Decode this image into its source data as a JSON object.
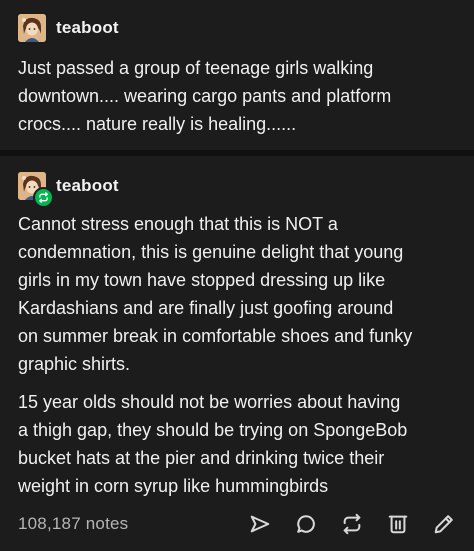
{
  "post": {
    "blocks": [
      {
        "username": "teaboot",
        "text": "Just passed a group of teenage girls walking\ndowntown.... wearing cargo pants and platform\ncrocs.... nature really is healing......"
      },
      {
        "username": "teaboot",
        "paragraphs": [
          "Cannot stress enough that this is NOT a\ncondemnation, this is genuine delight that young\ngirls in my town have stopped dressing up like\nKardashians and are finally just goofing around\non summer break in comfortable shoes and funky\ngraphic shirts.",
          "15 year olds should not be worries about having\na thigh gap, they should be trying on SpongeBob\nbucket hats at the pier and drinking twice their\nweight in corn syrup like hummingbirds"
        ]
      }
    ],
    "footer": {
      "notes": "108,187 notes",
      "actions": [
        "share-icon",
        "reply-icon",
        "reblog-icon",
        "delete-icon",
        "edit-icon"
      ]
    }
  },
  "colors": {
    "background": "#1c1c1c",
    "divider": "#101010",
    "text": "#f0f0f0",
    "muted": "#b5b5b5",
    "reblog_badge": "#00b84d"
  }
}
